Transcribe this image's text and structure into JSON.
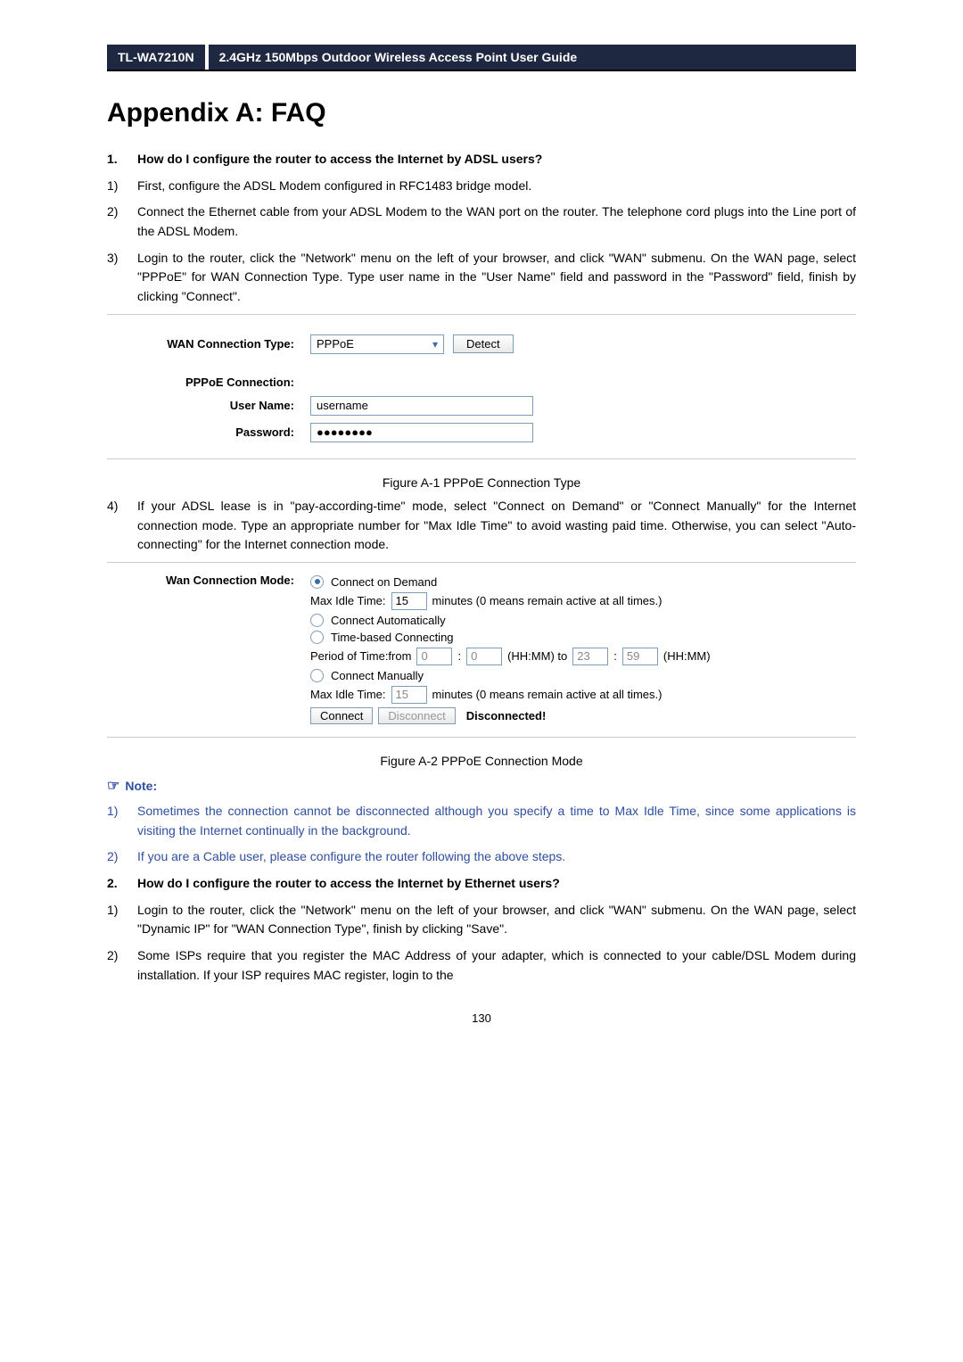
{
  "header": {
    "model": "TL-WA7210N",
    "title": "2.4GHz 150Mbps Outdoor Wireless Access Point User Guide"
  },
  "page_title": "Appendix A: FAQ",
  "q1": {
    "num": "1.",
    "text": "How do I configure the router to access the Internet by ADSL users?",
    "steps": {
      "s1_num": "1)",
      "s1_txt": "First, configure the ADSL Modem configured in RFC1483 bridge model.",
      "s2_num": "2)",
      "s2_txt": "Connect the Ethernet cable from your ADSL Modem to the WAN port on the router. The telephone cord plugs into the Line port of the ADSL Modem.",
      "s3_num": "3)",
      "s3_txt": "Login to the router, click the \"Network\" menu on the left of your browser, and click \"WAN\" submenu. On the WAN page, select \"PPPoE\" for WAN Connection Type. Type user name in the \"User Name\" field and password in the \"Password\" field, finish by clicking \"Connect\"."
    }
  },
  "shot1": {
    "wan_type_lbl": "WAN Connection Type:",
    "wan_type_val": "PPPoE",
    "detect_btn": "Detect",
    "pppoe_lbl": "PPPoE Connection:",
    "user_lbl": "User Name:",
    "user_val": "username",
    "pass_lbl": "Password:",
    "pass_val": "●●●●●●●●"
  },
  "fig1_caption": "Figure A-1 PPPoE Connection Type",
  "step4": {
    "num": "4)",
    "txt": "If your ADSL lease is in \"pay-according-time\" mode, select \"Connect on Demand\" or \"Connect Manually\" for the Internet connection mode. Type an appropriate number for \"Max Idle Time\" to avoid wasting paid time. Otherwise, you can select \"Auto-connecting\" for the Internet connection mode."
  },
  "shot2": {
    "mode_lbl": "Wan Connection Mode:",
    "opt1": "Connect on Demand",
    "idle_lbl": "Max Idle Time:",
    "idle1_val": "15",
    "idle_suffix": "minutes (0 means remain active at all times.)",
    "opt2": "Connect Automatically",
    "opt3": "Time-based Connecting",
    "period_lbl": "Period of Time:from",
    "p1": "0",
    "p2": "0",
    "hhmm_to": "(HH:MM) to",
    "p3": "23",
    "p4": "59",
    "hhmm": "(HH:MM)",
    "opt4": "Connect Manually",
    "idle2_val": "15",
    "connect_btn": "Connect",
    "disconnect_btn": "Disconnect",
    "status": "Disconnected!"
  },
  "fig2_caption": "Figure A-2 PPPoE Connection Mode",
  "note": {
    "head": "Note:",
    "n1_num": "1)",
    "n1_txt": "Sometimes the connection cannot be disconnected although you specify a time to Max Idle Time, since some applications is visiting the Internet continually in the background.",
    "n2_num": "2)",
    "n2_txt": "If you are a Cable user, please configure the router following the above steps."
  },
  "q2": {
    "num": "2.",
    "text": "How do I configure the router to access the Internet by Ethernet users?",
    "s1_num": "1)",
    "s1_txt": "Login to the router, click the \"Network\" menu on the left of your browser, and click \"WAN\" submenu. On the WAN page, select \"Dynamic IP\" for \"WAN Connection Type\", finish by clicking \"Save\".",
    "s2_num": "2)",
    "s2_txt": "Some ISPs require that you register the MAC Address of your adapter, which is connected to your cable/DSL Modem during installation. If your ISP requires MAC register, login to the"
  },
  "page_num": "130"
}
